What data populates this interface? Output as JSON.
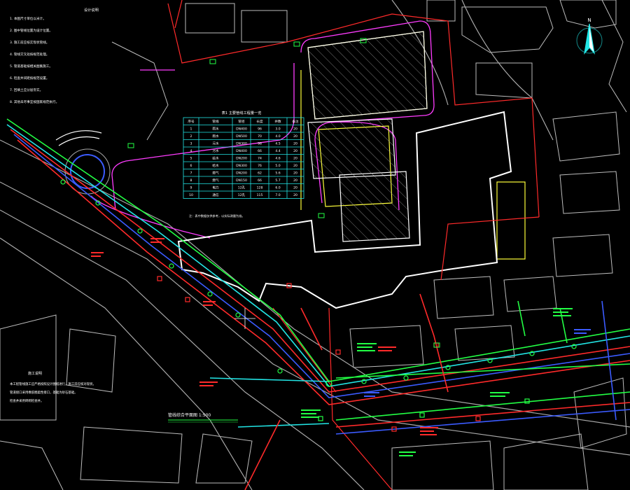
{
  "drawing": {
    "plan_title": "管线综合平面图 1:500",
    "notes_title": "设计说明",
    "notes_lines": [
      "1. 本图尺寸单位以米计。",
      "2. 图中管线位置为设计位置。",
      "3. 施工前应核实现状管线。",
      "4. 管线交叉处按规范处理。",
      "5. 管道基础按相关图集施工。",
      "6. 检查井间距按规范设置。",
      "7. 回填土应分层夯实。",
      "8. 其他未尽事宜按国家规范执行。"
    ],
    "table_title": "表1  主要管线工程量一览",
    "table_headers": [
      "序号",
      "管线",
      "管径",
      "长度",
      "井数",
      "备注"
    ],
    "table_rows": [
      [
        "1",
        "雨水",
        "DN400",
        "96",
        "3.0",
        "20"
      ],
      [
        "2",
        "雨水",
        "DN500",
        "70",
        "4.0",
        "20"
      ],
      [
        "3",
        "污水",
        "DN300",
        "98",
        "4.5",
        "20"
      ],
      [
        "4",
        "污水",
        "DN400",
        "66",
        "4.4",
        "20"
      ],
      [
        "5",
        "给水",
        "DN200",
        "74",
        "4.6",
        "20"
      ],
      [
        "6",
        "给水",
        "DN300",
        "76",
        "5.0",
        "20"
      ],
      [
        "7",
        "燃气",
        "DN200",
        "62",
        "5.6",
        "20"
      ],
      [
        "8",
        "燃气",
        "DN150",
        "66",
        "5.7",
        "20"
      ],
      [
        "9",
        "电力",
        "12孔",
        "128",
        "6.0",
        "20"
      ],
      [
        "10",
        "通信",
        "12孔",
        "115",
        "7.0",
        "20"
      ]
    ],
    "table_footnote": "注：表中数据仅供参考，以实际测量为准。",
    "bottom_note_title": "施工说明",
    "bottom_note_lines": [
      "本工程管线施工应严格按照设计图纸进行，施工前应核对现状。",
      "管道接口采用橡胶圈柔性接口，基础为砂石基础。",
      "检查井采用砖砌检查井。"
    ],
    "north_label": "N",
    "colors": {
      "background": "#000000",
      "building": "#ffffff",
      "road_edge": "#c8c8c8",
      "red_line": "#ff2a2a",
      "green_line": "#22ff44",
      "blue_line": "#3b5bff",
      "cyan_line": "#22e5e5",
      "magenta_line": "#ff3cff",
      "yellow_line": "#ffff3a"
    },
    "icons": [
      "north-arrow-icon"
    ]
  }
}
